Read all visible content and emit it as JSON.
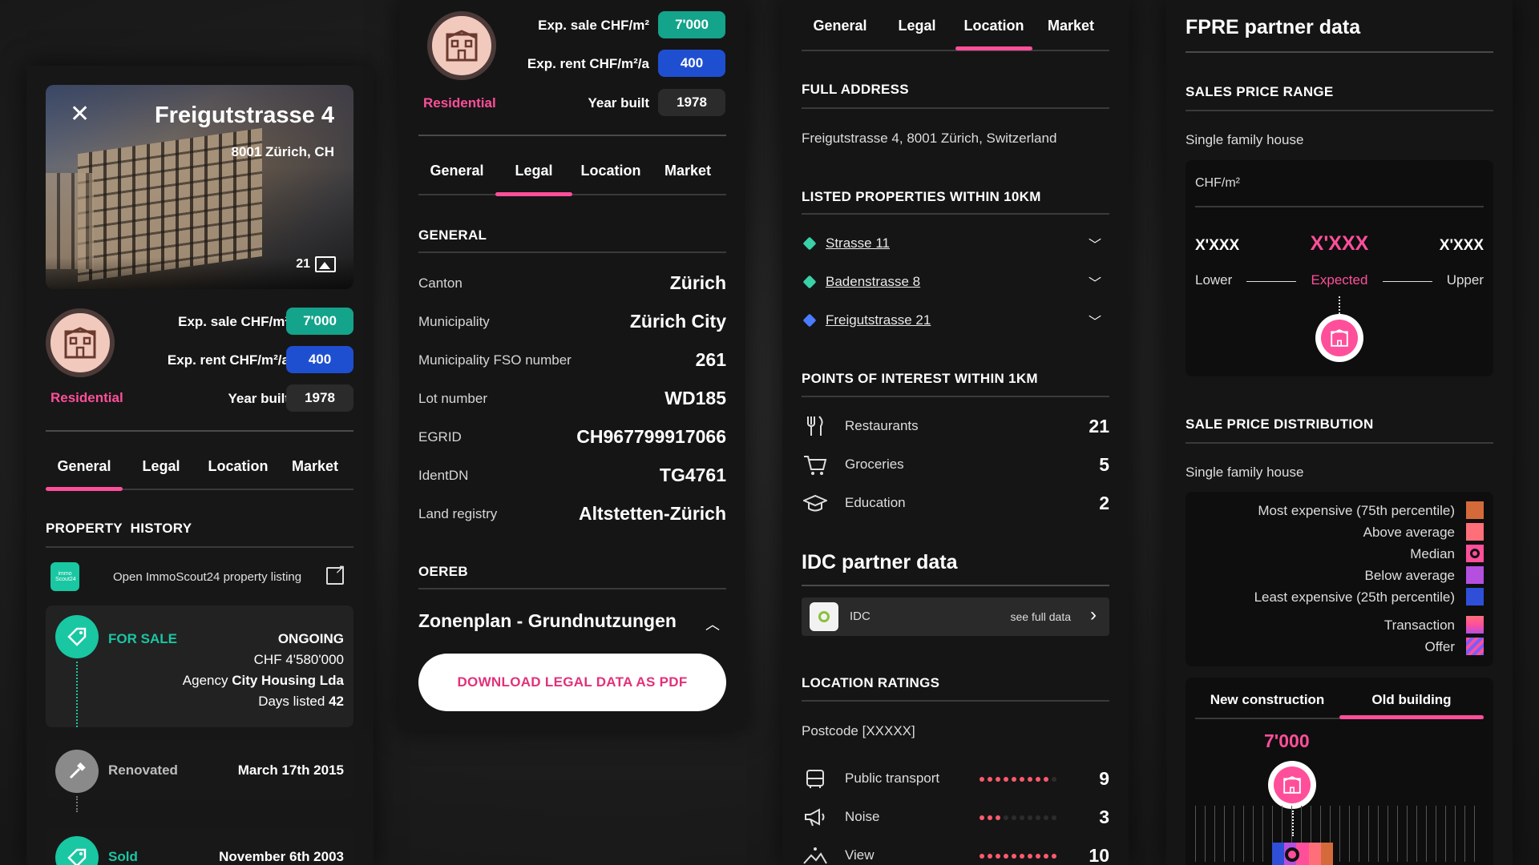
{
  "colors": {
    "accent_pink": "#ff4f9a",
    "green": "#14a38b",
    "blue": "#1f4fd1",
    "dark_bg": "#151515"
  },
  "tabs": [
    "General",
    "Legal",
    "Location",
    "Market"
  ],
  "header": {
    "street": "Freigutstrasse 4",
    "city": "8001 Zürich, CH",
    "photo_count": "21",
    "exp_sale_label": "Exp. sale CHF/m²",
    "exp_sale_value": "7'000",
    "exp_rent_label": "Exp. rent CHF/m²/a",
    "exp_rent_value": "400",
    "type": "Residential",
    "year_label": "Year built",
    "year_value": "1978"
  },
  "general": {
    "history_title": "PROPERTY  HISTORY",
    "immoscout_logo_text": "immo Scout24",
    "immoscout_link": "Open ImmoScout24 property listing",
    "for_sale": {
      "status": "FOR SALE",
      "state": "ONGOING",
      "price": "CHF 4'580'000",
      "agency_prefix": "Agency",
      "agency": "City Housing Lda",
      "days_prefix": "Days listed",
      "days": "42"
    },
    "renovated": {
      "label": "Renovated",
      "date": "March 17th 2015"
    },
    "sold": {
      "label": "Sold",
      "date": "November 6th 2003"
    }
  },
  "legal": {
    "section_general": "GENERAL",
    "rows": [
      {
        "label": "Canton",
        "value": "Zürich"
      },
      {
        "label": "Municipality",
        "value": "Zürich City"
      },
      {
        "label": "Municipality FSO number",
        "value": "261"
      },
      {
        "label": "Lot number",
        "value": "WD185"
      },
      {
        "label": "EGRID",
        "value": "CH967799917066"
      },
      {
        "label": "IdentDN",
        "value": "TG4761"
      },
      {
        "label": "Land registry",
        "value": "Altstetten-Zürich"
      }
    ],
    "section_oereb": "OEREB",
    "zonenplan": "Zonenplan - Grundnutzungen",
    "download_btn": "DOWNLOAD LEGAL DATA AS PDF"
  },
  "location": {
    "full_address_title": "FULL ADDRESS",
    "full_address": "Freigutstrasse 4, 8001 Zürich, Switzerland",
    "listed_title": "LISTED PROPERTIES WITHIN 10KM",
    "listed": [
      {
        "name": "Strasse 11",
        "color": "#3ad0a8"
      },
      {
        "name": "Badenstrasse 8",
        "color": "#3ad0a8"
      },
      {
        "name": "Freigutstrasse 21",
        "color": "#4a7cff"
      }
    ],
    "poi_title": "POINTS OF INTEREST WITHIN 1KM",
    "poi": [
      {
        "icon": "cutlery-icon",
        "label": "Restaurants",
        "count": "21"
      },
      {
        "icon": "cart-icon",
        "label": "Groceries",
        "count": "5"
      },
      {
        "icon": "graduation-cap-icon",
        "label": "Education",
        "count": "2"
      }
    ],
    "idc_title": "IDC partner data",
    "idc_label": "IDC",
    "idc_link": "see full data",
    "ratings_title": "LOCATION RATINGS",
    "postcode": "Postcode [XXXXX]",
    "ratings": [
      {
        "icon": "bus-icon",
        "label": "Public transport",
        "value": "9",
        "score": 9
      },
      {
        "icon": "megaphone-icon",
        "label": "Noise",
        "value": "3",
        "score": 3
      },
      {
        "icon": "view-icon",
        "label": "View",
        "value": "10",
        "score": 10
      }
    ]
  },
  "market": {
    "title": "FPRE partner data",
    "range_title": "SALES PRICE RANGE",
    "range_subtitle": "Single family house",
    "unit": "CHF/m²",
    "lower_value": "X'XXX",
    "expected_value": "X'XXX",
    "upper_value": "X'XXX",
    "lower_label": "Lower",
    "expected_label": "Expected",
    "upper_label": "Upper",
    "dist_title": "SALE PRICE DISTRIBUTION",
    "dist_subtitle": "Single family house",
    "legend": [
      {
        "label": "Most expensive (75th percentile)",
        "color": "#d46a3a"
      },
      {
        "label": "Above average",
        "color": "#ff6f7a"
      },
      {
        "label": "Median",
        "color": "#ff4f9a"
      },
      {
        "label": "Below average",
        "color": "#b44fe0"
      },
      {
        "label": "Least expensive (25th percentile)",
        "color": "#2f4fd8"
      },
      {
        "label": "Transaction",
        "color": "#ff4f9a"
      },
      {
        "label": "Offer",
        "color": "#7a5cff"
      }
    ],
    "tab_new": "New construction",
    "tab_old": "Old building",
    "dist_value": "7'000"
  }
}
